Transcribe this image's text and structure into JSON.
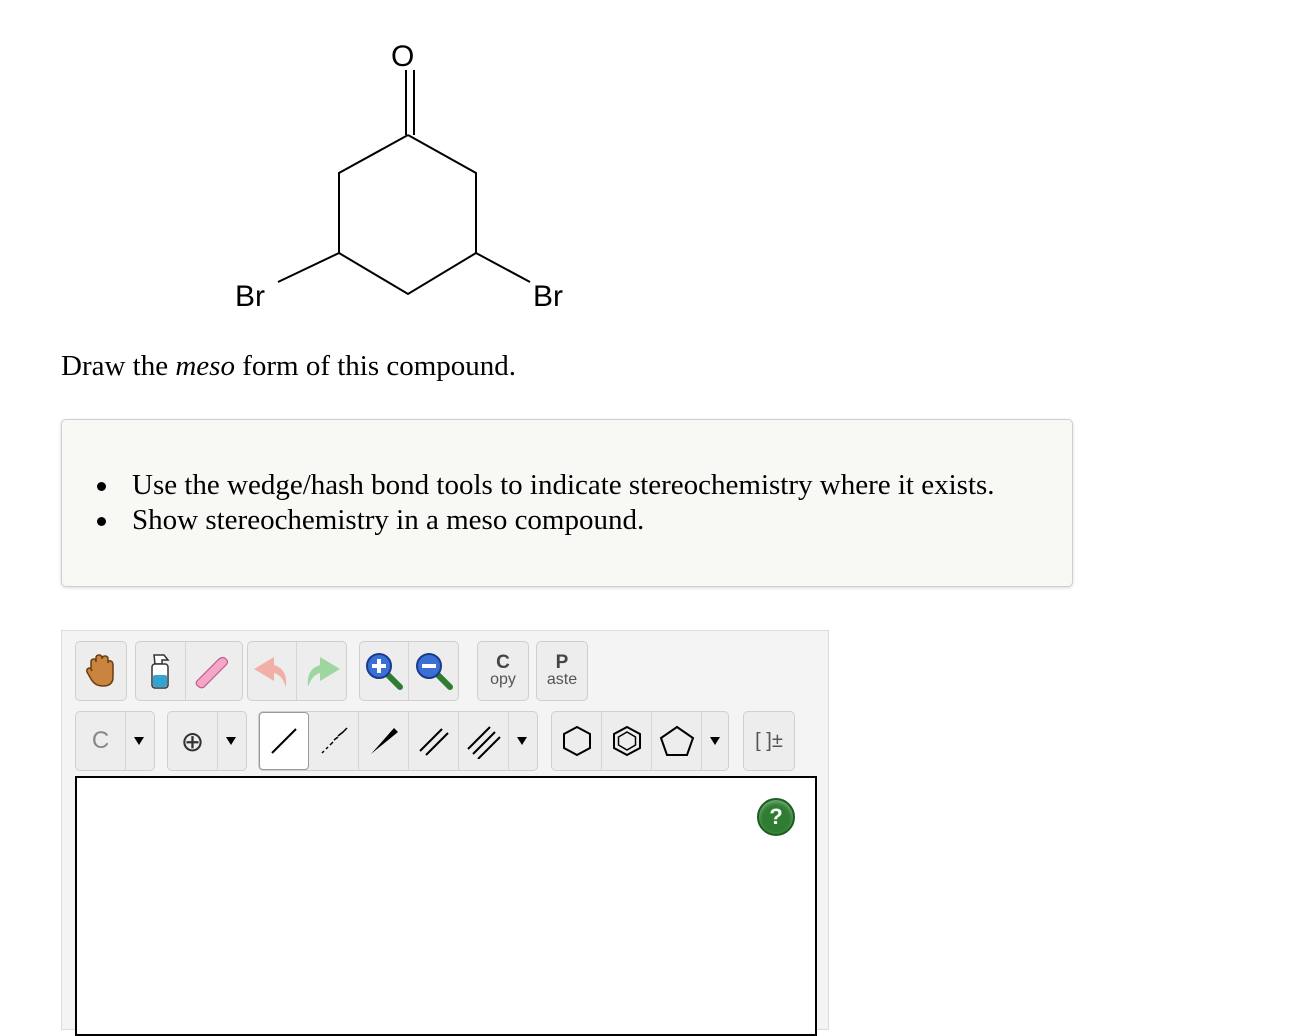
{
  "molecule": {
    "atoms": {
      "oxygen": "O",
      "bromine_left": "Br",
      "bromine_right": "Br"
    }
  },
  "question": {
    "prefix": "Draw the ",
    "emphasis": "meso",
    "suffix": " form of this compound."
  },
  "instructions": [
    "Use the wedge/hash bond tools to indicate stereochemistry where it exists.",
    "Show stereochemistry in a meso compound."
  ],
  "toolbar": {
    "row1": {
      "move": "hand-icon",
      "clean": "spray-bottle-icon",
      "erase": "eraser-icon",
      "undo": "undo-arrow-icon",
      "redo": "redo-arrow-icon",
      "zoom_in": "zoom-in-icon",
      "zoom_out": "zoom-out-icon",
      "copy": {
        "big": "C",
        "small": "opy"
      },
      "paste": {
        "big": "P",
        "small": "aste"
      }
    },
    "row2": {
      "atom_selected": "C",
      "charge_symbol": "⊕",
      "bracket_label": "[ ]±"
    }
  },
  "help": {
    "label": "?"
  },
  "colors": {
    "help_green": "#2e7d32",
    "panel_bg": "#f8f8f4"
  }
}
